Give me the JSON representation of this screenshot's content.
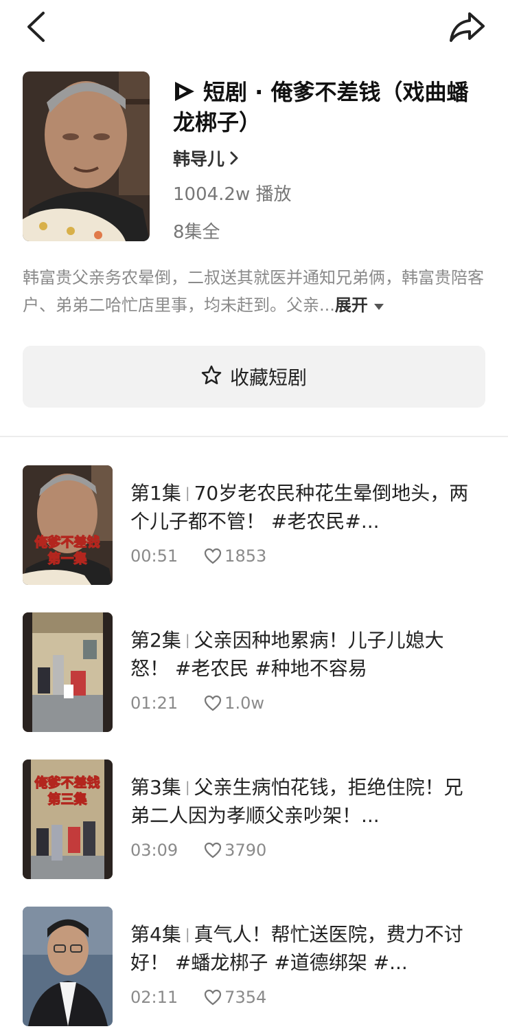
{
  "drama": {
    "category": "短剧",
    "title": "俺爹不差钱（戏曲蟠龙梆子）",
    "author": "韩导儿",
    "plays": "1004.2w 播放",
    "episodes_total": "8集全",
    "description": "韩富贵父亲务农晕倒，二叔送其就医并通知兄弟俩，韩富贵陪客户、弟弟二哈忙店里事，均未赶到。父亲...",
    "expand_label": "展开",
    "favorite_label": "收藏短剧"
  },
  "episodes": [
    {
      "number": "第1集",
      "title": "70岁老农民种花生晕倒地头，两个儿子都不管！ #老农民#...",
      "duration": "00:51",
      "likes": "1853",
      "thumb_caption": [
        "俺爹不差钱",
        "第一集"
      ]
    },
    {
      "number": "第2集",
      "title": "父亲因种地累病！儿子儿媳大怒！ #老农民 #种地不容易",
      "duration": "01:21",
      "likes": "1.0w",
      "thumb_caption": []
    },
    {
      "number": "第3集",
      "title": "父亲生病怕花钱，拒绝住院！兄弟二人因为孝顺父亲吵架！...",
      "duration": "03:09",
      "likes": "3790",
      "thumb_caption": [
        "俺爹不差钱",
        "第三集"
      ]
    },
    {
      "number": "第4集",
      "title": "真气人！帮忙送医院，费力不讨好！ #蟠龙梆子 #道德绑架 #...",
      "duration": "02:11",
      "likes": "7354",
      "thumb_caption": []
    }
  ],
  "icons": {
    "back": "chevron-left-icon",
    "share": "share-arrow-icon",
    "play_logo": "play-logo-icon",
    "author_chevron": "chevron-right-icon",
    "expand": "triangle-down-icon",
    "favorite": "star-outline-icon",
    "likes": "heart-outline-icon"
  }
}
